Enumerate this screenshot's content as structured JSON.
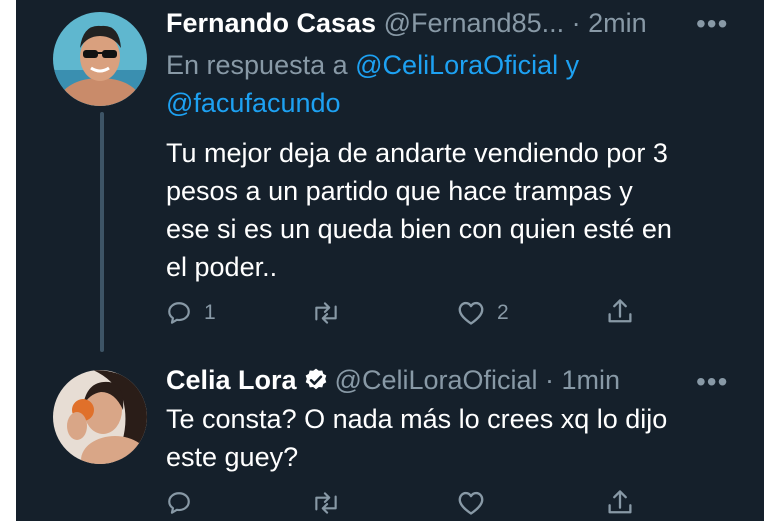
{
  "tweet1": {
    "name": "Fernando Casas",
    "handle": "@Fernand85...",
    "time": "· 2min",
    "more_icon": "more-dots-icon",
    "reply_prefix": "En respuesta a",
    "mention1": "@CeliLoraOficial",
    "mention_joiner": "y",
    "mention2": "@facufacundo",
    "text_lines": [
      "Tu mejor deja de andarte vendiendo por 3",
      "pesos a un partido que hace trampas y",
      "ese si es un queda bien con quien esté en",
      "el poder.."
    ],
    "reply_count": "1",
    "like_count": "2"
  },
  "tweet2": {
    "name": "Celia Lora",
    "handle": "@CeliLoraOficial",
    "time": "· 1min",
    "more_icon": "more-dots-icon",
    "text_lines": [
      "Te consta? O nada más lo crees xq lo dijo",
      "este guey?"
    ]
  },
  "colors": {
    "background": "#15202b",
    "text": "#ffffff",
    "secondary": "#8899a6",
    "link": "#1da1f2"
  }
}
